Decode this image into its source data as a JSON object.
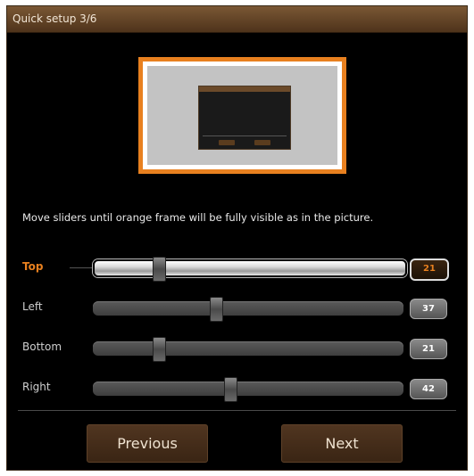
{
  "window": {
    "title": "Quick setup 3/6"
  },
  "instruction": "Move sliders until orange frame will be fully visible as in the picture.",
  "sliders": [
    {
      "label": "Top",
      "value": "21",
      "level": 0.2,
      "active": true
    },
    {
      "label": "Left",
      "value": "37",
      "level": 0.39,
      "active": false
    },
    {
      "label": "Bottom",
      "value": "21",
      "level": 0.2,
      "active": false
    },
    {
      "label": "Right",
      "value": "42",
      "level": 0.44,
      "active": false
    }
  ],
  "buttons": {
    "previous": "Previous",
    "next": "Next"
  },
  "colors": {
    "accent": "#e8801f",
    "titlebar": "#6b4a2a",
    "button": "#4a301b"
  }
}
